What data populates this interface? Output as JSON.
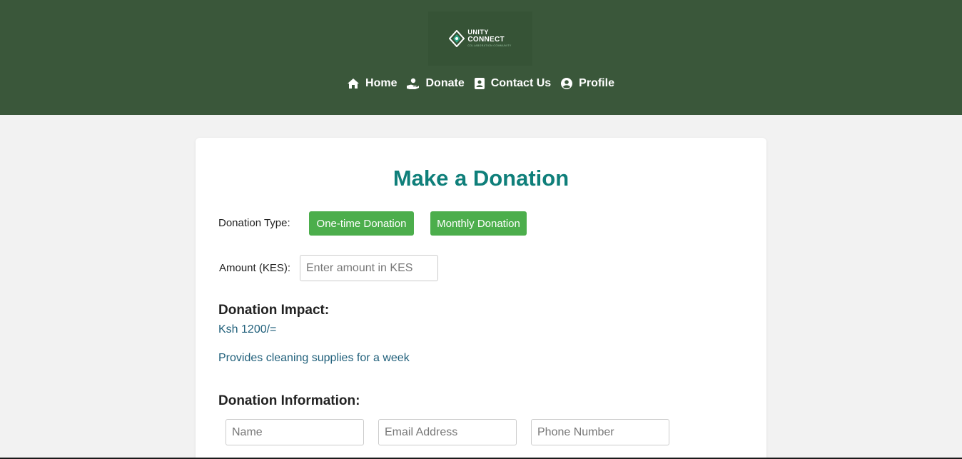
{
  "header": {
    "logo": {
      "line1": "UNITY",
      "line2": "CONNECT",
      "line3": "COLLABORATION COMMUNITY"
    },
    "nav": [
      {
        "label": "Home",
        "icon": "home-icon"
      },
      {
        "label": "Donate",
        "icon": "donate-hand-icon"
      },
      {
        "label": "Contact Us",
        "icon": "contact-book-icon"
      },
      {
        "label": "Profile",
        "icon": "user-circle-icon"
      }
    ]
  },
  "form": {
    "title": "Make a Donation",
    "donation_type_label": "Donation Type:",
    "one_time_label": "One-time Donation",
    "monthly_label": "Monthly Donation",
    "amount_label": "Amount (KES):",
    "amount_placeholder": "Enter amount in KES",
    "impact_heading": "Donation Impact:",
    "impact_amount": "Ksh 1200/=",
    "impact_description": "Provides cleaning supplies for a week",
    "info_heading": "Donation Information:",
    "name_placeholder": "Name",
    "email_placeholder": "Email Address",
    "phone_placeholder": "Phone Number"
  },
  "colors": {
    "header_bg": "#3a573a",
    "title": "#0f7f7a",
    "button_bg": "#4cae4c",
    "impact_text": "#1f5f7a"
  }
}
